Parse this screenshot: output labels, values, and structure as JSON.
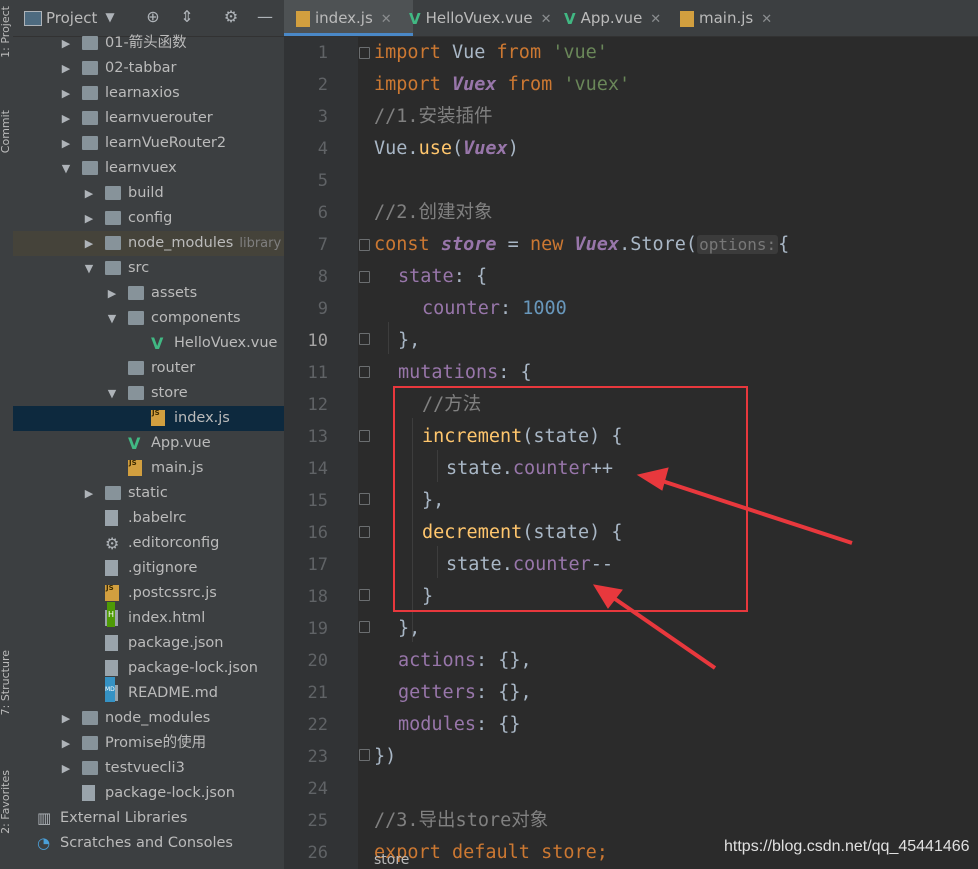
{
  "stripe": {
    "project_label": "1: Project",
    "commit_label": "Commit",
    "structure_label": "7: Structure",
    "favorites_label": "2: Favorites"
  },
  "project_panel": {
    "title": "Project"
  },
  "tree": [
    {
      "label": "01-箭头函数",
      "type": "folder",
      "expanded": false
    },
    {
      "label": "02-tabbar",
      "type": "folder",
      "expanded": false
    },
    {
      "label": "learnaxios",
      "type": "folder",
      "expanded": false
    },
    {
      "label": "learnvuerouter",
      "type": "folder",
      "expanded": false
    },
    {
      "label": "learnVueRouter2",
      "type": "folder",
      "expanded": false
    },
    {
      "label": "learnvuex",
      "type": "folder",
      "expanded": true
    },
    {
      "label": "build",
      "type": "folder",
      "expanded": false
    },
    {
      "label": "config",
      "type": "folder",
      "expanded": false
    },
    {
      "label": "node_modules",
      "type": "folder",
      "expanded": false,
      "note": "library roo"
    },
    {
      "label": "src",
      "type": "folder",
      "expanded": true
    },
    {
      "label": "assets",
      "type": "folder",
      "expanded": false
    },
    {
      "label": "components",
      "type": "folder",
      "expanded": true
    },
    {
      "label": "HelloVuex.vue",
      "type": "vue"
    },
    {
      "label": "router",
      "type": "folder"
    },
    {
      "label": "store",
      "type": "folder",
      "expanded": true
    },
    {
      "label": "index.js",
      "type": "js",
      "selected": true
    },
    {
      "label": "App.vue",
      "type": "vue"
    },
    {
      "label": "main.js",
      "type": "js"
    },
    {
      "label": "static",
      "type": "folder",
      "expanded": false
    },
    {
      "label": ".babelrc",
      "type": "file"
    },
    {
      "label": ".editorconfig",
      "type": "gear"
    },
    {
      "label": ".gitignore",
      "type": "file"
    },
    {
      "label": ".postcssrc.js",
      "type": "js"
    },
    {
      "label": "index.html",
      "type": "html"
    },
    {
      "label": "package.json",
      "type": "file"
    },
    {
      "label": "package-lock.json",
      "type": "file"
    },
    {
      "label": "README.md",
      "type": "md"
    },
    {
      "label": "node_modules",
      "type": "folder",
      "expanded": false
    },
    {
      "label": "Promise的使用",
      "type": "folder",
      "expanded": false
    },
    {
      "label": "testvuecli3",
      "type": "folder",
      "expanded": false
    },
    {
      "label": "package-lock.json",
      "type": "file"
    },
    {
      "label": "External Libraries",
      "type": "libs"
    },
    {
      "label": "Scratches and Consoles",
      "type": "scratch"
    }
  ],
  "tabs": [
    {
      "label": "index.js",
      "icon": "js-file-icon",
      "active": true
    },
    {
      "label": "HelloVuex.vue",
      "icon": "vue-file-icon",
      "active": false
    },
    {
      "label": "App.vue",
      "icon": "vue-file-icon",
      "active": false
    },
    {
      "label": "main.js",
      "icon": "js-file-icon",
      "active": false
    }
  ],
  "editor": {
    "current_line": "10",
    "line_numbers": [
      "1",
      "2",
      "3",
      "4",
      "5",
      "6",
      "7",
      "8",
      "9",
      "10",
      "11",
      "12",
      "13",
      "14",
      "15",
      "16",
      "17",
      "18",
      "19",
      "20",
      "21",
      "22",
      "23",
      "24",
      "25",
      "26"
    ],
    "code": {
      "l1": {
        "a": "import",
        "b": " Vue ",
        "c": "from",
        "d": " 'vue'"
      },
      "l2": {
        "a": "import",
        "b": " ",
        "c": "Vuex",
        "d": " ",
        "e": "from",
        "f": " 'vuex'"
      },
      "l3": {
        "a": "//1.安装插件"
      },
      "l4": {
        "a": "Vue.",
        "b": "use",
        "c": "(",
        "d": "Vuex",
        "e": ")"
      },
      "l6": {
        "a": "//2.创建对象"
      },
      "l7": {
        "a": "const",
        "b": " ",
        "c": "store",
        "d": " = ",
        "e": "new",
        "f": " ",
        "g": "Vuex",
        "h": ".Store(",
        "i": "options:",
        "j": "{"
      },
      "l8": {
        "a": "state",
        "b": ": {"
      },
      "l9": {
        "a": "counter",
        "b": ": ",
        "c": "1000"
      },
      "l10": {
        "a": "},"
      },
      "l11": {
        "a": "mutations",
        "b": ": {"
      },
      "l12": {
        "a": "//方法"
      },
      "l13": {
        "a": "increment",
        "b": "(state) {"
      },
      "l14": {
        "a": "state.",
        "b": "counter",
        "c": "++"
      },
      "l15": {
        "a": "},"
      },
      "l16": {
        "a": "decrement",
        "b": "(state) {"
      },
      "l17": {
        "a": "state.",
        "b": "counter",
        "c": "--"
      },
      "l18": {
        "a": "}"
      },
      "l19": {
        "a": "},"
      },
      "l20": {
        "a": "actions",
        "b": ": {},"
      },
      "l21": {
        "a": "getters",
        "b": ": {},"
      },
      "l22": {
        "a": "modules",
        "b": ": {}"
      },
      "l23": {
        "a": "})"
      },
      "l25": {
        "a": "//3.导出store对象"
      },
      "l26": {
        "a": "export default store;"
      }
    },
    "breadcrumb": "store"
  },
  "annotation_color": "#e8383d",
  "watermark": "https://blog.csdn.net/qq_45441466"
}
